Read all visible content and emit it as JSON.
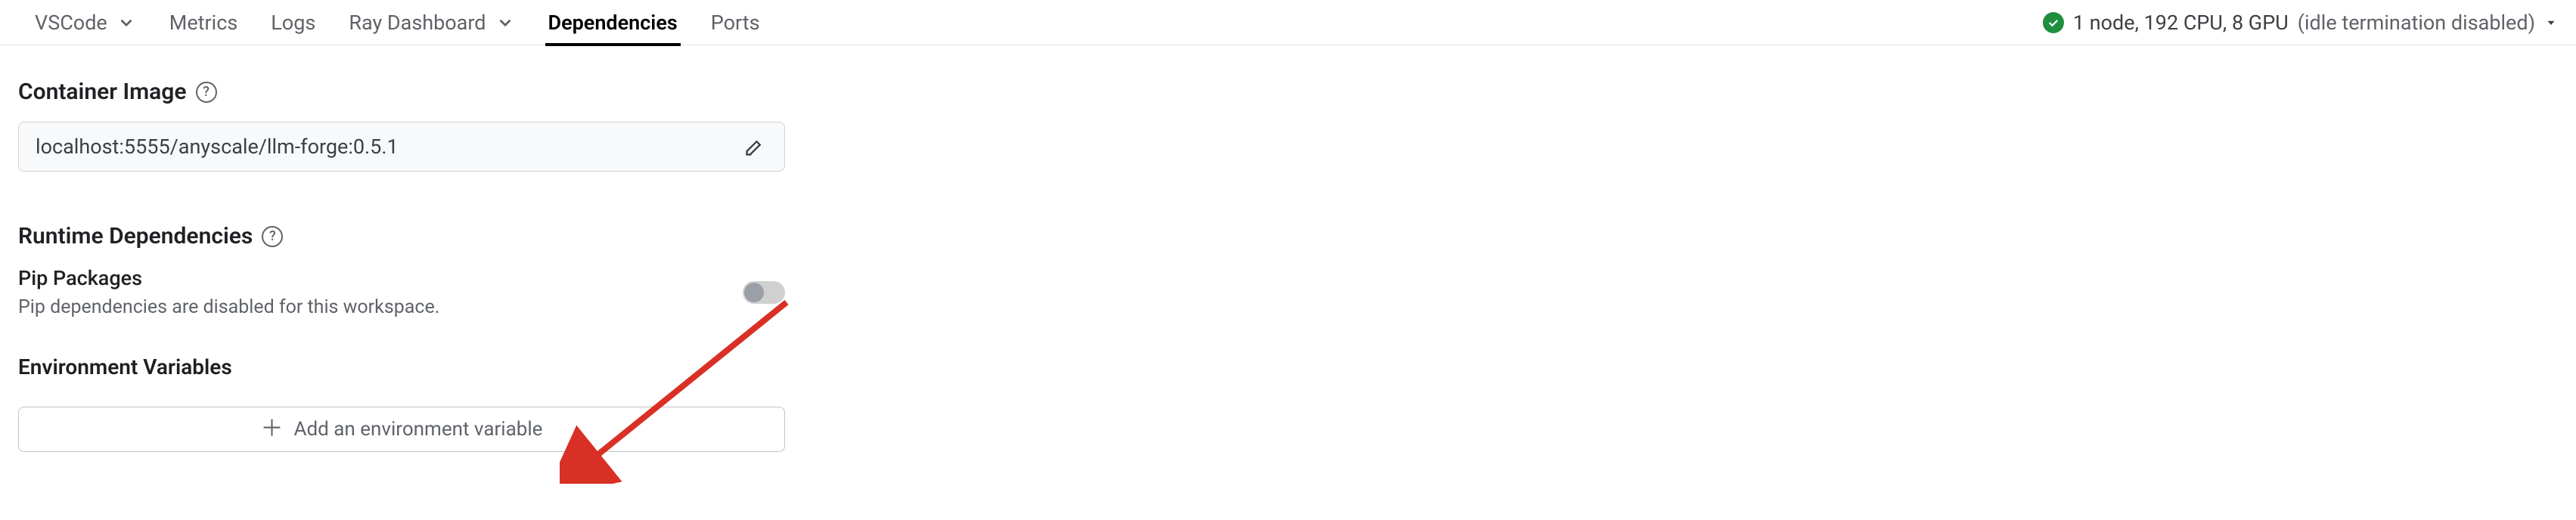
{
  "tabs": {
    "vscode": "VSCode",
    "metrics": "Metrics",
    "logs": "Logs",
    "ray": "Ray Dashboard",
    "dependencies": "Dependencies",
    "ports": "Ports"
  },
  "status": {
    "text": "1 node, 192 CPU, 8 GPU",
    "extra": "(idle termination disabled)"
  },
  "containerImage": {
    "title": "Container Image",
    "value": "localhost:5555/anyscale/llm-forge:0.5.1"
  },
  "runtime": {
    "title": "Runtime Dependencies",
    "pip": {
      "title": "Pip Packages",
      "desc": "Pip dependencies are disabled for this workspace.",
      "enabled": false
    },
    "env": {
      "title": "Environment Variables",
      "addLabel": "Add an environment variable"
    }
  }
}
